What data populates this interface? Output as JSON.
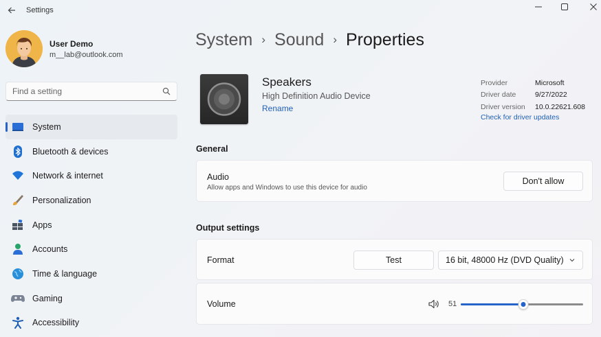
{
  "window": {
    "title": "Settings",
    "minimize_glyph": "—",
    "maximize_glyph": "☐",
    "close_glyph": "✕"
  },
  "user": {
    "name": "User Demo",
    "email": "m__lab@outlook.com"
  },
  "search": {
    "placeholder": "Find a setting"
  },
  "sidebar": {
    "items": [
      {
        "label": "System",
        "icon": "system-icon",
        "active": true
      },
      {
        "label": "Bluetooth & devices",
        "icon": "bluetooth-icon",
        "active": false
      },
      {
        "label": "Network & internet",
        "icon": "network-icon",
        "active": false
      },
      {
        "label": "Personalization",
        "icon": "brush-icon",
        "active": false
      },
      {
        "label": "Apps",
        "icon": "apps-icon",
        "active": false
      },
      {
        "label": "Accounts",
        "icon": "accounts-icon",
        "active": false
      },
      {
        "label": "Time & language",
        "icon": "globe-icon",
        "active": false
      },
      {
        "label": "Gaming",
        "icon": "gamepad-icon",
        "active": false
      },
      {
        "label": "Accessibility",
        "icon": "accessibility-icon",
        "active": false
      }
    ]
  },
  "breadcrumb": {
    "items": [
      "System",
      "Sound"
    ],
    "separator": "›",
    "current": "Properties"
  },
  "device": {
    "name": "Speakers",
    "description": "High Definition Audio Device",
    "rename_label": "Rename"
  },
  "driver_info": {
    "labels": [
      "Provider",
      "Driver date",
      "Driver version"
    ],
    "values": [
      "Microsoft",
      "9/27/2022",
      "10.0.22621.608"
    ],
    "update_link": "Check for driver updates"
  },
  "general": {
    "title": "General",
    "audio": {
      "label": "Audio",
      "description": "Allow apps and Windows to use this device for audio",
      "button": "Don't allow"
    }
  },
  "output": {
    "title": "Output settings",
    "format": {
      "label": "Format",
      "test_button": "Test",
      "selected": "16 bit, 48000 Hz (DVD Quality)"
    },
    "volume": {
      "label": "Volume",
      "value": "51",
      "level": 0.51
    }
  },
  "colors": {
    "accent": "#2563c8",
    "link": "#1f5fb5"
  }
}
